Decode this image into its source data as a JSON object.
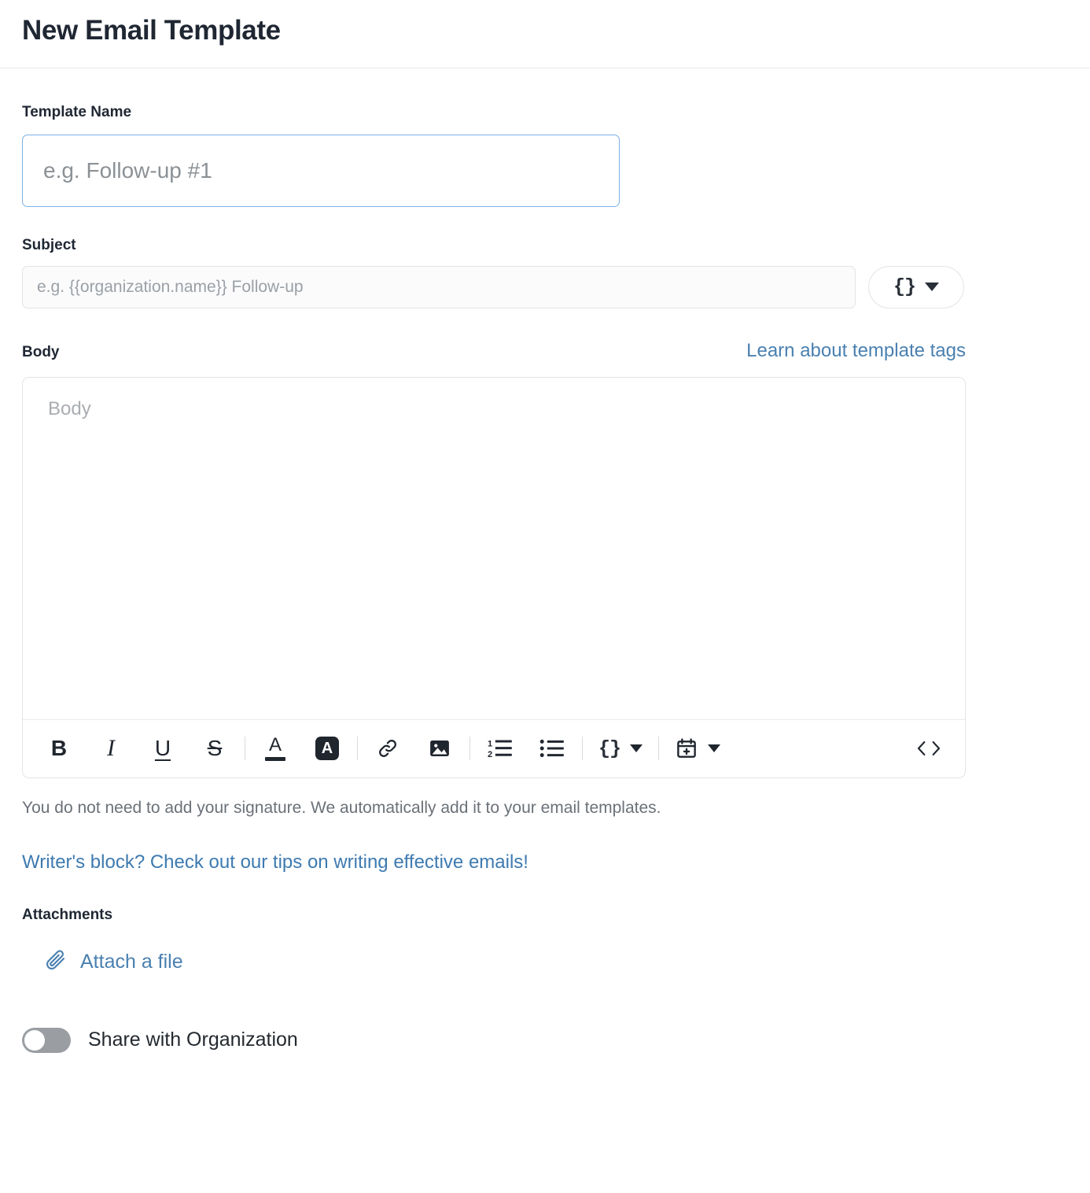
{
  "header": {
    "title": "New Email Template"
  },
  "form": {
    "template_name": {
      "label": "Template Name",
      "value": "",
      "placeholder": "e.g. Follow-up #1",
      "focused": true
    },
    "subject": {
      "label": "Subject",
      "value": "",
      "placeholder": "e.g. {{organization.name}} Follow-up",
      "tag_button": {
        "glyph": "{}",
        "icon": "braces-icon",
        "caret": "chevron-down-icon"
      }
    },
    "body": {
      "label": "Body",
      "learn_link": "Learn about template tags",
      "placeholder": "Body",
      "toolbar": [
        {
          "name": "bold-button",
          "glyph": "B"
        },
        {
          "name": "italic-button",
          "glyph": "I"
        },
        {
          "name": "underline-button",
          "glyph": "U"
        },
        {
          "name": "strikethrough-button",
          "glyph": "S"
        },
        {
          "name": "text-color-button",
          "glyph": "A"
        },
        {
          "name": "highlight-color-button",
          "glyph": "A"
        },
        {
          "name": "link-button",
          "glyph": "link-icon"
        },
        {
          "name": "image-button",
          "glyph": "image-icon"
        },
        {
          "name": "ordered-list-button",
          "glyph": "ordered-list-icon"
        },
        {
          "name": "bullet-list-button",
          "glyph": "bullet-list-icon"
        },
        {
          "name": "template-tag-button",
          "glyph": "{}"
        },
        {
          "name": "schedule-button",
          "glyph": "calendar-plus-icon"
        },
        {
          "name": "source-code-button",
          "glyph": "<>"
        }
      ]
    },
    "signature_note": "You do not need to add your signature. We automatically add it to your email templates.",
    "writers_block_link": "Writer's block? Check out our tips on writing effective emails!"
  },
  "attachments": {
    "label": "Attachments",
    "attach_link": "Attach a file",
    "icon": "paperclip-icon"
  },
  "share": {
    "label": "Share with Organization",
    "enabled": false
  },
  "colors": {
    "focus_border": "#7cb1e8",
    "link_blue": "#4a80b0",
    "text_dark": "#1f2733",
    "muted_text": "#6b7178",
    "border_gray": "#e2e4e7",
    "toggle_off": "#9a9ea3"
  }
}
